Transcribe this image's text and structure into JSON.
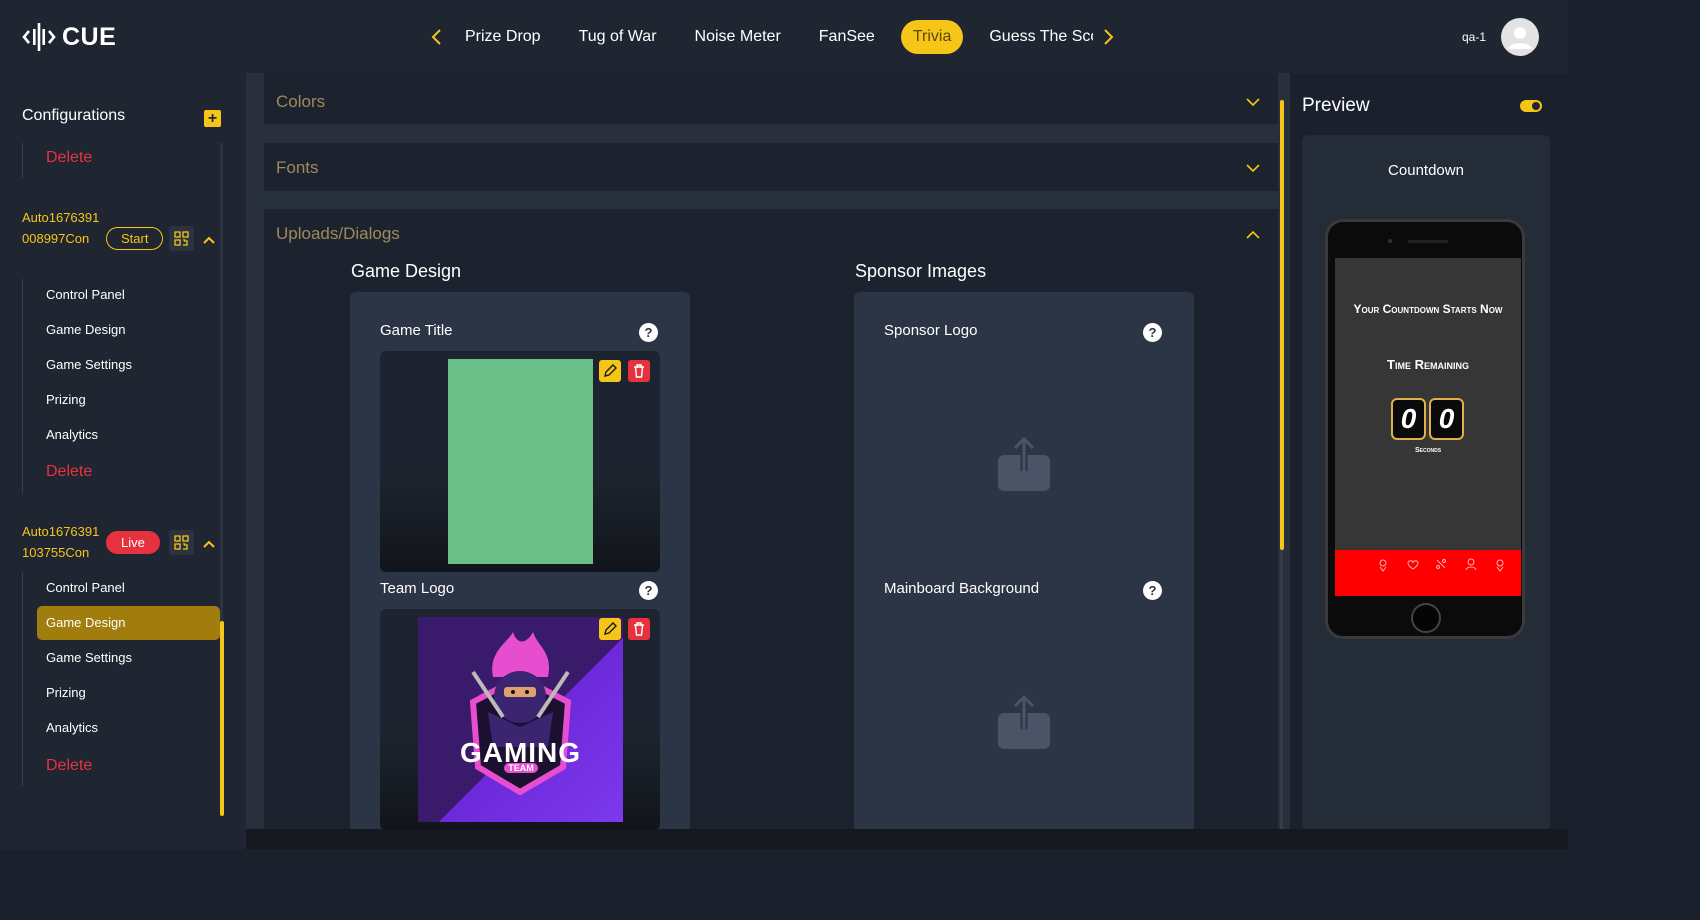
{
  "header": {
    "logo_text": "CUE",
    "tabs": [
      {
        "label": "Prize Drop",
        "active": false
      },
      {
        "label": "Tug of War",
        "active": false
      },
      {
        "label": "Noise Meter",
        "active": false
      },
      {
        "label": "FanSee",
        "active": false
      },
      {
        "label": "Trivia",
        "active": true
      },
      {
        "label": "Guess The Sco",
        "active": false
      }
    ],
    "prev_icon": "chevron-left-icon",
    "next_icon": "chevron-right-icon",
    "user_name": "qa-1",
    "avatar_icon": "user-avatar-icon"
  },
  "sidebar": {
    "title": "Configurations",
    "add_icon": "plus-icon",
    "top_delete": "Delete",
    "games": [
      {
        "id": "Auto1676391008997Con",
        "status": "Start",
        "items": [
          "Control Panel",
          "Game Design",
          "Game Settings",
          "Prizing",
          "Analytics"
        ],
        "delete": "Delete"
      },
      {
        "id": "Auto1676391103755Con",
        "status": "Live",
        "items": [
          "Control Panel",
          "Game Design",
          "Game Settings",
          "Prizing",
          "Analytics"
        ],
        "active_item": "Game Design",
        "delete": "Delete"
      }
    ]
  },
  "main": {
    "accordions": [
      {
        "title": "Colors",
        "expanded": false
      },
      {
        "title": "Fonts",
        "expanded": false
      },
      {
        "title": "Uploads/Dialogs",
        "expanded": true
      }
    ],
    "game_design": {
      "title": "Game Design",
      "uploads": [
        {
          "label": "Game Title",
          "has_image": true
        },
        {
          "label": "Team Logo",
          "has_image": true,
          "logo_text": "GAMING",
          "logo_subtext": "TEAM"
        }
      ]
    },
    "sponsor_images": {
      "title": "Sponsor Images",
      "uploads": [
        {
          "label": "Sponsor Logo",
          "has_image": false
        },
        {
          "label": "Mainboard Background",
          "has_image": false
        }
      ]
    }
  },
  "preview": {
    "title": "Preview",
    "toggle_on": true,
    "screen_name": "Countdown",
    "phone": {
      "headline": "Your Countdown Starts Now",
      "subhead": "Time Remaining",
      "digits": [
        "0",
        "0"
      ],
      "unit": "Seconds"
    }
  },
  "colors": {
    "accent": "#f5c518",
    "danger": "#e6323e",
    "game_title_fill": "#69bf86"
  }
}
